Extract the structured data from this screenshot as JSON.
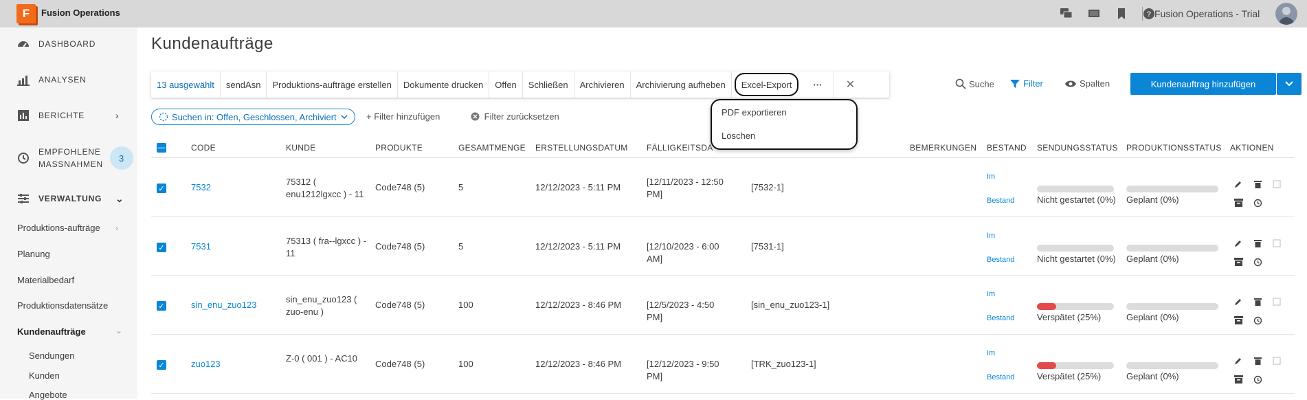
{
  "app": {
    "logo_letter": "F",
    "title": "Fusion Operations",
    "account": "Fusion Operations - Trial"
  },
  "sidebar": {
    "items": [
      {
        "label": "DASHBOARD"
      },
      {
        "label": "ANALYSEN"
      },
      {
        "label": "BERICHTE"
      },
      {
        "label": "EMPFOHLENE MASSNAHMEN",
        "badge": "3"
      },
      {
        "label": "VERWALTUNG"
      }
    ],
    "sub": [
      "Produktions-aufträge",
      "Planung",
      "Materialbedarf",
      "Produktionsdatensätze",
      "Kundenaufträge"
    ],
    "subsub": [
      "Sendungen",
      "Kunden",
      "Angebote"
    ]
  },
  "page": {
    "title": "Kundenaufträge"
  },
  "toolbar": {
    "items": [
      "13 ausgewählt",
      "sendAsn",
      "Produktions-aufträge erstellen",
      "Dokumente drucken",
      "Offen",
      "Schließen",
      "Archivieren",
      "Archivierung aufheben",
      "Excel-Export"
    ],
    "more": "···",
    "close": "✕",
    "search": "Suche",
    "filter": "Filter",
    "columns": "Spalten",
    "add": "Kundenauftrag hinzufügen"
  },
  "filters": {
    "chip": "Suchen in: Offen, Geschlossen, Archiviert",
    "add": "+ Filter hinzufügen",
    "reset": "Filter zurücksetzen"
  },
  "menu": {
    "items": [
      "PDF exportieren",
      "Löschen"
    ]
  },
  "table": {
    "headers": [
      "CODE",
      "KUNDE",
      "PRODUKTE",
      "GESAMTMENGE",
      "ERSTELLUNGSDATUM",
      "FÄLLIGKEITSDA",
      "BEMERKUNGEN",
      "BESTAND",
      "SENDUNGSSTATUS",
      "PRODUKTIONSSTATUS",
      "AKTIONEN"
    ],
    "rows": [
      {
        "code": "7532",
        "kunde": "75312 ( enu1212lgxcc ) - 11",
        "produkte": "Code748 (5)",
        "menge": "5",
        "erstellt": "12/12/2023 - 5:11 PM",
        "faellig": "[12/11/2023 - 12:50 PM]",
        "ref": "[7532-1]",
        "bestand1": "Im",
        "bestand2": "Bestand",
        "sendung": "Nicht gestartet (0%)",
        "sendung_pct": 0,
        "produktion": "Geplant (0%)",
        "produktion_pct": 0
      },
      {
        "code": "7531",
        "kunde": "75313 ( fra--lgxcc ) - 11",
        "produkte": "Code748 (5)",
        "menge": "5",
        "erstellt": "12/12/2023 - 5:11 PM",
        "faellig": "[12/10/2023 - 6:00 AM]",
        "ref": "[7531-1]",
        "bestand1": "Im",
        "bestand2": "Bestand",
        "sendung": "Nicht gestartet (0%)",
        "sendung_pct": 0,
        "produktion": "Geplant (0%)",
        "produktion_pct": 0
      },
      {
        "code": "sin_enu_zuo123",
        "kunde": "sin_enu_zuo123 ( zuo-enu )",
        "produkte": "Code748 (5)",
        "menge": "100",
        "erstellt": "12/12/2023 - 8:46 PM",
        "faellig": "[12/5/2023 - 4:50 PM]",
        "ref": "[sin_enu_zuo123-1]",
        "bestand1": "Im",
        "bestand2": "Bestand",
        "sendung": "Verspätet (25%)",
        "sendung_pct": 25,
        "produktion": "Geplant (0%)",
        "produktion_pct": 0
      },
      {
        "code": "zuo123",
        "kunde": "Z-0 ( 001 ) - AC10",
        "produkte": "Code748 (5)",
        "menge": "100",
        "erstellt": "12/12/2023 - 8:46 PM",
        "faellig": "[12/12/2023 - 9:50 PM]",
        "ref": "[TRK_zuo123-1]",
        "bestand1": "Im",
        "bestand2": "Bestand",
        "sendung": "Verspätet (25%)",
        "sendung_pct": 25,
        "produktion": "Geplant (0%)",
        "produktion_pct": 0
      }
    ]
  },
  "colors": {
    "accent": "#0b86d6",
    "late": "#e34b4b",
    "logo": "#f26b1d"
  }
}
